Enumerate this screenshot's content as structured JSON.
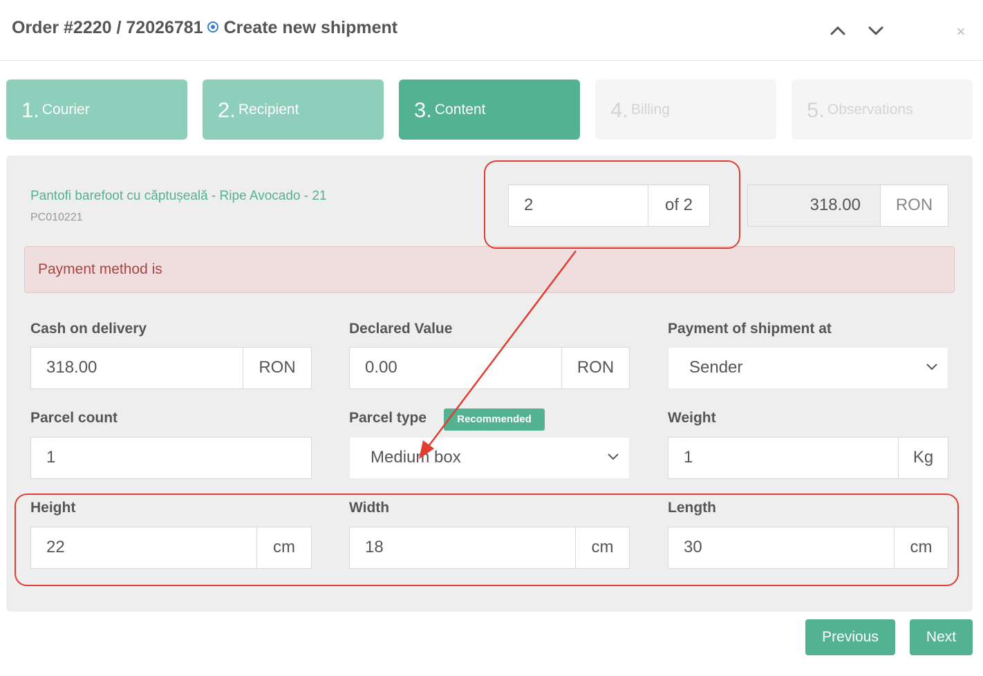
{
  "header": {
    "order_label": "Order #2220 / 72026781",
    "subtitle": "Create new shipment",
    "close_glyph": "×"
  },
  "steps": [
    {
      "num": "1.",
      "label": "Courier",
      "state": "done"
    },
    {
      "num": "2.",
      "label": "Recipient",
      "state": "done"
    },
    {
      "num": "3.",
      "label": "Content",
      "state": "active"
    },
    {
      "num": "4.",
      "label": "Billing",
      "state": "todo"
    },
    {
      "num": "5.",
      "label": "Observations",
      "state": "todo"
    }
  ],
  "product": {
    "name": "Pantofi barefoot cu căptușeală - Ripe Avocado - 21",
    "sku": "PC010221",
    "quantity": "2",
    "quantity_of": "of 2",
    "price": "318.00",
    "currency": "RON"
  },
  "alert": {
    "message": "Payment method is"
  },
  "fields": {
    "cod": {
      "label": "Cash on delivery",
      "value": "318.00",
      "unit": "RON"
    },
    "declared": {
      "label": "Declared Value",
      "value": "0.00",
      "unit": "RON"
    },
    "payment": {
      "label": "Payment of shipment at",
      "value": "Sender"
    },
    "parcel_count": {
      "label": "Parcel count",
      "value": "1"
    },
    "parcel_type": {
      "label": "Parcel type",
      "badge": "Recommended",
      "value": "Medium box"
    },
    "weight": {
      "label": "Weight",
      "value": "1",
      "unit": "Kg"
    },
    "height": {
      "label": "Height",
      "value": "22",
      "unit": "cm"
    },
    "width": {
      "label": "Width",
      "value": "18",
      "unit": "cm"
    },
    "length": {
      "label": "Length",
      "value": "30",
      "unit": "cm"
    }
  },
  "buttons": {
    "previous": "Previous",
    "next": "Next"
  },
  "colors": {
    "accent": "#52b292",
    "accent_light": "#8dcfbb",
    "annotation": "#e03c31",
    "alert_text": "#a94442"
  }
}
